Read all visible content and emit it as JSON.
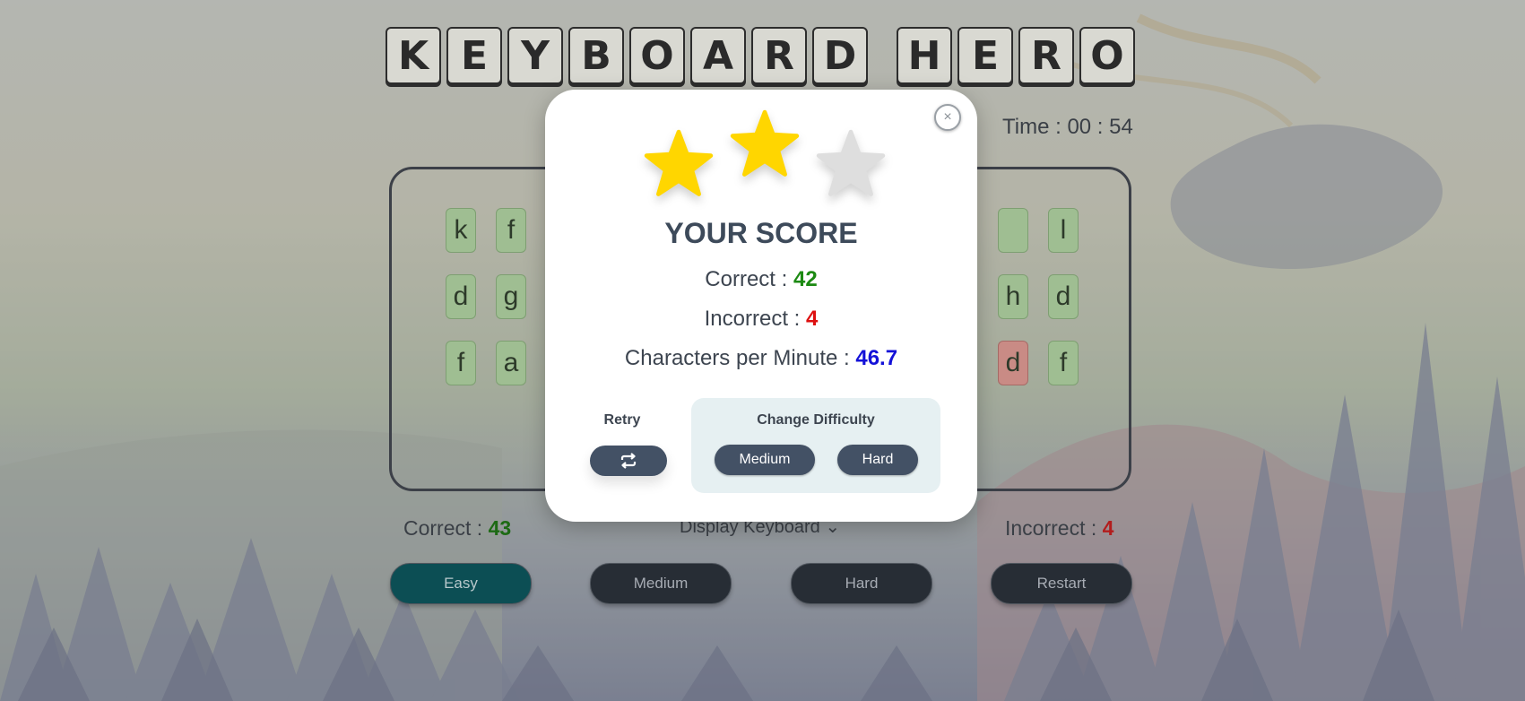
{
  "header": {
    "title_letters": [
      "K",
      "E",
      "Y",
      "B",
      "O",
      "A",
      "R",
      "D",
      "H",
      "E",
      "R",
      "O"
    ],
    "timer": "Time : 00 : 54"
  },
  "board": {
    "tiles": [
      "k",
      "f",
      "",
      "l",
      "d",
      "g",
      "h",
      "d",
      "f",
      "a",
      "d",
      "f"
    ]
  },
  "footer": {
    "correct_label": "Correct : ",
    "correct_value": "43",
    "incorrect_label": "Incorrect : ",
    "incorrect_value": "4",
    "display_keyboard": "Display Keyboard",
    "buttons": {
      "easy": "Easy",
      "medium": "Medium",
      "hard": "Hard",
      "restart": "Restart"
    }
  },
  "modal": {
    "stars_earned": 2,
    "stars_total": 3,
    "title": "YOUR SCORE",
    "correct_label": "Correct : ",
    "correct_value": "42",
    "incorrect_label": "Incorrect : ",
    "incorrect_value": "4",
    "cpm_label": "Characters per Minute : ",
    "cpm_value": "46.7",
    "retry_label": "Retry",
    "change_difficulty_label": "Change Difficulty",
    "difficulty_options": [
      "Medium",
      "Hard"
    ],
    "close_glyph": "×"
  },
  "colors": {
    "star_filled": "#ffd600",
    "star_empty": "#dedede",
    "correct": "#1c8a12",
    "incorrect": "#dd1010",
    "cpm": "#1311d8",
    "button_dark": "#435165"
  }
}
